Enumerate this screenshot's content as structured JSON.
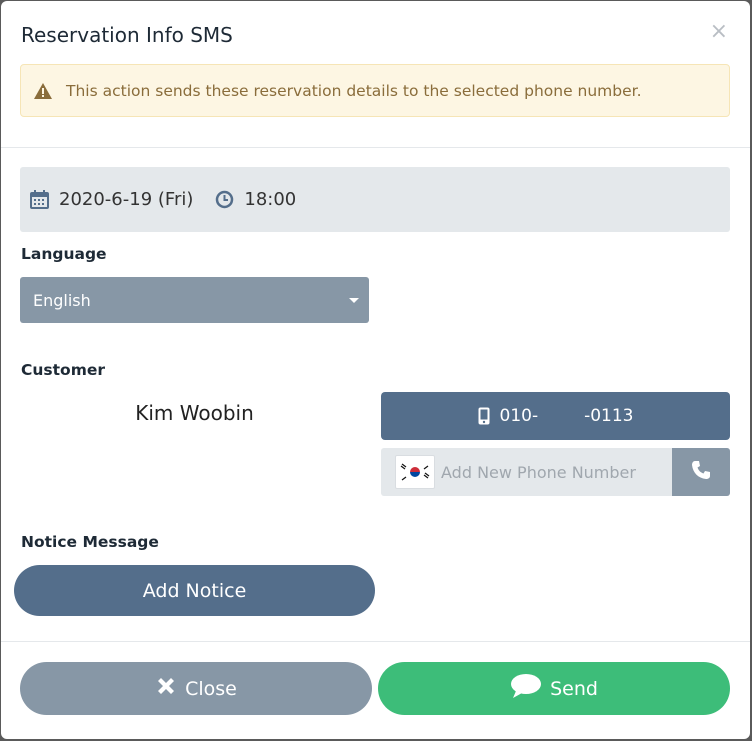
{
  "modal": {
    "title": "Reservation Info SMS",
    "close_symbol": "×"
  },
  "alert": {
    "icon": "warning-icon",
    "text": "This action sends these reservation details to the selected phone number."
  },
  "reservation": {
    "date_icon": "calendar-icon",
    "date": "2020-6-19 (Fri)",
    "time_icon": "clock-icon",
    "time": "18:00"
  },
  "language": {
    "label": "Language",
    "selected": "English"
  },
  "customer": {
    "label": "Customer",
    "name": "Kim Woobin",
    "phone_prefix": "010-",
    "phone_suffix": "-0113",
    "phone_icon": "mobile-icon",
    "add_phone_placeholder": "Add New Phone Number",
    "country_flag": "south-korea-flag-icon",
    "call_icon": "phone-icon"
  },
  "notice": {
    "label": "Notice Message",
    "add_button": "Add Notice"
  },
  "footer": {
    "close_label": "Close",
    "send_label": "Send"
  },
  "colors": {
    "slate": "#546e8b",
    "muted": "#8797a6",
    "green": "#3dbd79",
    "alert_bg": "#fdf6e3",
    "alert_text": "#8a6d3b"
  }
}
